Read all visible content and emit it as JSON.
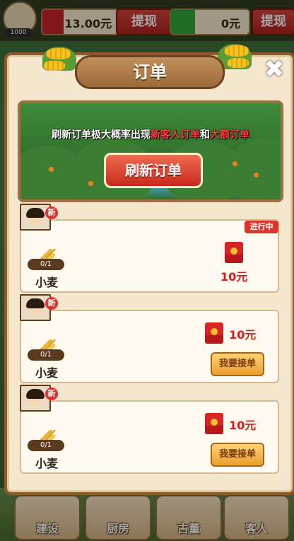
{
  "hud": {
    "level": "1000",
    "cash_value": "13.00元",
    "withdraw_label_1": "提现",
    "wechat_value": "0元",
    "withdraw_label_2": "提现"
  },
  "modal": {
    "title": "订单",
    "close_glyph": "✖",
    "banner_hint_prefix": "刷新订单极大概率出现",
    "banner_hint_highlight_1": "新客人订单",
    "banner_hint_mid": "和",
    "banner_hint_highlight_2": "大额订单",
    "refresh_button": "刷新订单"
  },
  "orders": [
    {
      "new_badge": "新",
      "progress": "0/1",
      "item": "小麦",
      "reward": "10元",
      "status": "进行中",
      "accept_label": ""
    },
    {
      "new_badge": "新",
      "progress": "0/1",
      "item": "小麦",
      "reward": "10元",
      "status": "",
      "accept_label": "我要接单"
    },
    {
      "new_badge": "新",
      "progress": "0/1",
      "item": "小麦",
      "reward": "10元",
      "status": "",
      "accept_label": "我要接单"
    }
  ],
  "bottom_nav": [
    {
      "label": "建设"
    },
    {
      "label": "厨房"
    },
    {
      "label": "古董"
    },
    {
      "label": "客人"
    }
  ],
  "colors": {
    "accent_red": "#d1201f",
    "modal_bg": "#f4e7ce",
    "modal_border": "#8d5a2b"
  }
}
